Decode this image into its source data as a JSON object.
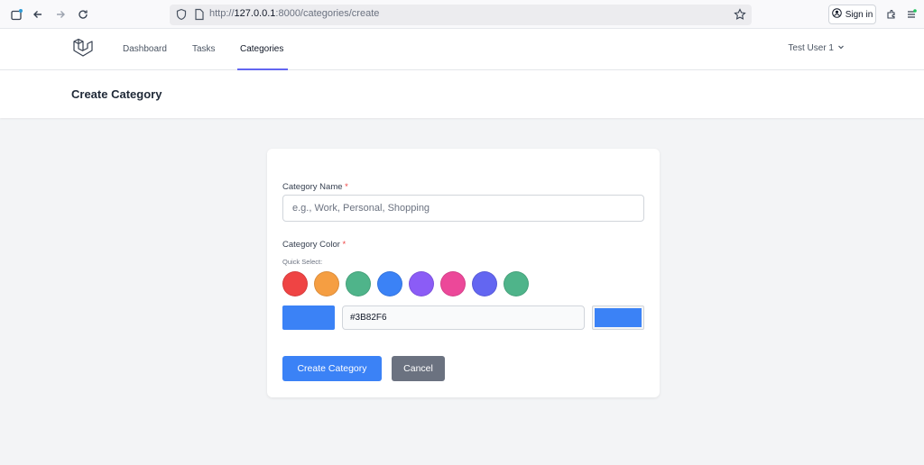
{
  "browser": {
    "url_scheme": "http://",
    "url_host": "127.0.0.1",
    "url_path": ":8000/categories/create",
    "sign_in_label": "Sign in"
  },
  "nav": {
    "links": [
      {
        "label": "Dashboard"
      },
      {
        "label": "Tasks"
      },
      {
        "label": "Categories",
        "active": true
      }
    ],
    "user_name": "Test User 1",
    "user_chevron": "⌄"
  },
  "page": {
    "title": "Create Category"
  },
  "form": {
    "name_label": "Category Name",
    "name_placeholder": "e.g., Work, Personal, Shopping",
    "required_mark": "*",
    "color_label": "Category Color",
    "quick_select_label": "Quick Select:",
    "swatches": [
      "#ef4444",
      "#f59e42",
      "#4fb48a",
      "#3b82f6",
      "#8b5cf6",
      "#ec4899",
      "#6366f1",
      "#4fb48a"
    ],
    "hex_value": "#3B82F6",
    "selected_color": "#3b82f6",
    "submit_label": "Create Category",
    "cancel_label": "Cancel"
  },
  "colors": {
    "primary": "#3b82f6",
    "secondary": "#6b7280",
    "accent": "#6366f1"
  }
}
